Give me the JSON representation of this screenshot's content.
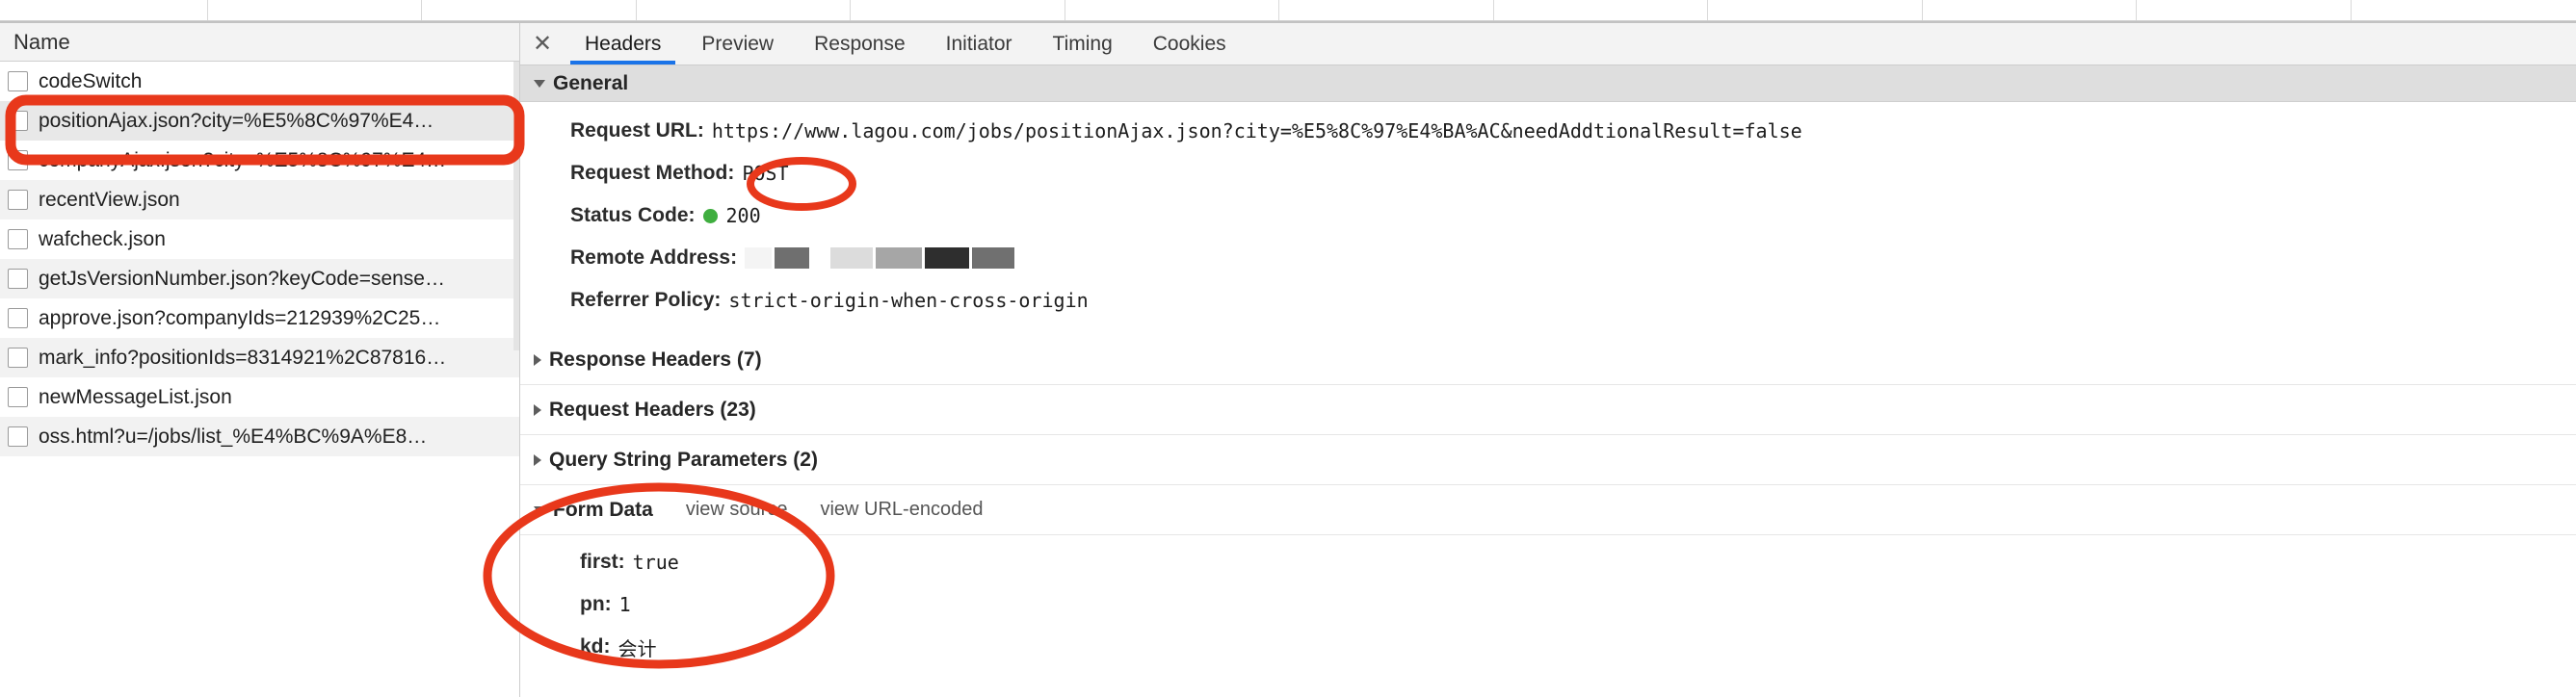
{
  "accent": {
    "annotation_red": "#e8381b",
    "tab_active_blue": "#1a73e8",
    "status_green": "#3fae3f"
  },
  "request_panel": {
    "column_header": "Name",
    "rows": [
      {
        "name": "codeSwitch",
        "selected": false
      },
      {
        "name": "positionAjax.json?city=%E5%8C%97%E4…",
        "selected": true
      },
      {
        "name": "companyAjax.json?city=%E5%8C%97%E4…",
        "selected": false
      },
      {
        "name": "recentView.json",
        "selected": false
      },
      {
        "name": "wafcheck.json",
        "selected": false
      },
      {
        "name": "getJsVersionNumber.json?keyCode=sense…",
        "selected": false
      },
      {
        "name": "approve.json?companyIds=212939%2C25…",
        "selected": false
      },
      {
        "name": "mark_info?positionIds=8314921%2C87816…",
        "selected": false
      },
      {
        "name": "newMessageList.json",
        "selected": false
      },
      {
        "name": "oss.html?u=/jobs/list_%E4%BC%9A%E8…",
        "selected": false
      }
    ]
  },
  "detail_panel": {
    "close_icon": "close-icon",
    "tabs": [
      {
        "label": "Headers",
        "active": true
      },
      {
        "label": "Preview",
        "active": false
      },
      {
        "label": "Response",
        "active": false
      },
      {
        "label": "Initiator",
        "active": false
      },
      {
        "label": "Timing",
        "active": false
      },
      {
        "label": "Cookies",
        "active": false
      }
    ],
    "general": {
      "title": "General",
      "expanded": true,
      "rows": [
        {
          "key": "Request URL:",
          "value": "https://www.lagou.com/jobs/positionAjax.json?city=%E5%8C%97%E4%BA%AC&needAddtionalResult=false",
          "type": "text"
        },
        {
          "key": "Request Method:",
          "value": "POST",
          "type": "text"
        },
        {
          "key": "Status Code:",
          "value": "200",
          "type": "status"
        },
        {
          "key": "Remote Address:",
          "value": "",
          "type": "redacted"
        },
        {
          "key": "Referrer Policy:",
          "value": "strict-origin-when-cross-origin",
          "type": "text"
        }
      ]
    },
    "collapsed_sections": [
      {
        "title": "Response Headers (7)"
      },
      {
        "title": "Request Headers (23)"
      },
      {
        "title": "Query String Parameters (2)"
      }
    ],
    "form_data": {
      "title": "Form Data",
      "view_source_label": "view source",
      "view_url_encoded_label": "view URL-encoded",
      "entries": [
        {
          "key": "first:",
          "value": "true"
        },
        {
          "key": "pn:",
          "value": "1"
        },
        {
          "key": "kd:",
          "value": "会计"
        }
      ]
    }
  },
  "annotations": [
    {
      "shape": "rounded-rect",
      "target": "positionAjax-row"
    },
    {
      "shape": "ellipse",
      "target": "request-method-post"
    },
    {
      "shape": "ellipse",
      "target": "form-data-block"
    }
  ]
}
